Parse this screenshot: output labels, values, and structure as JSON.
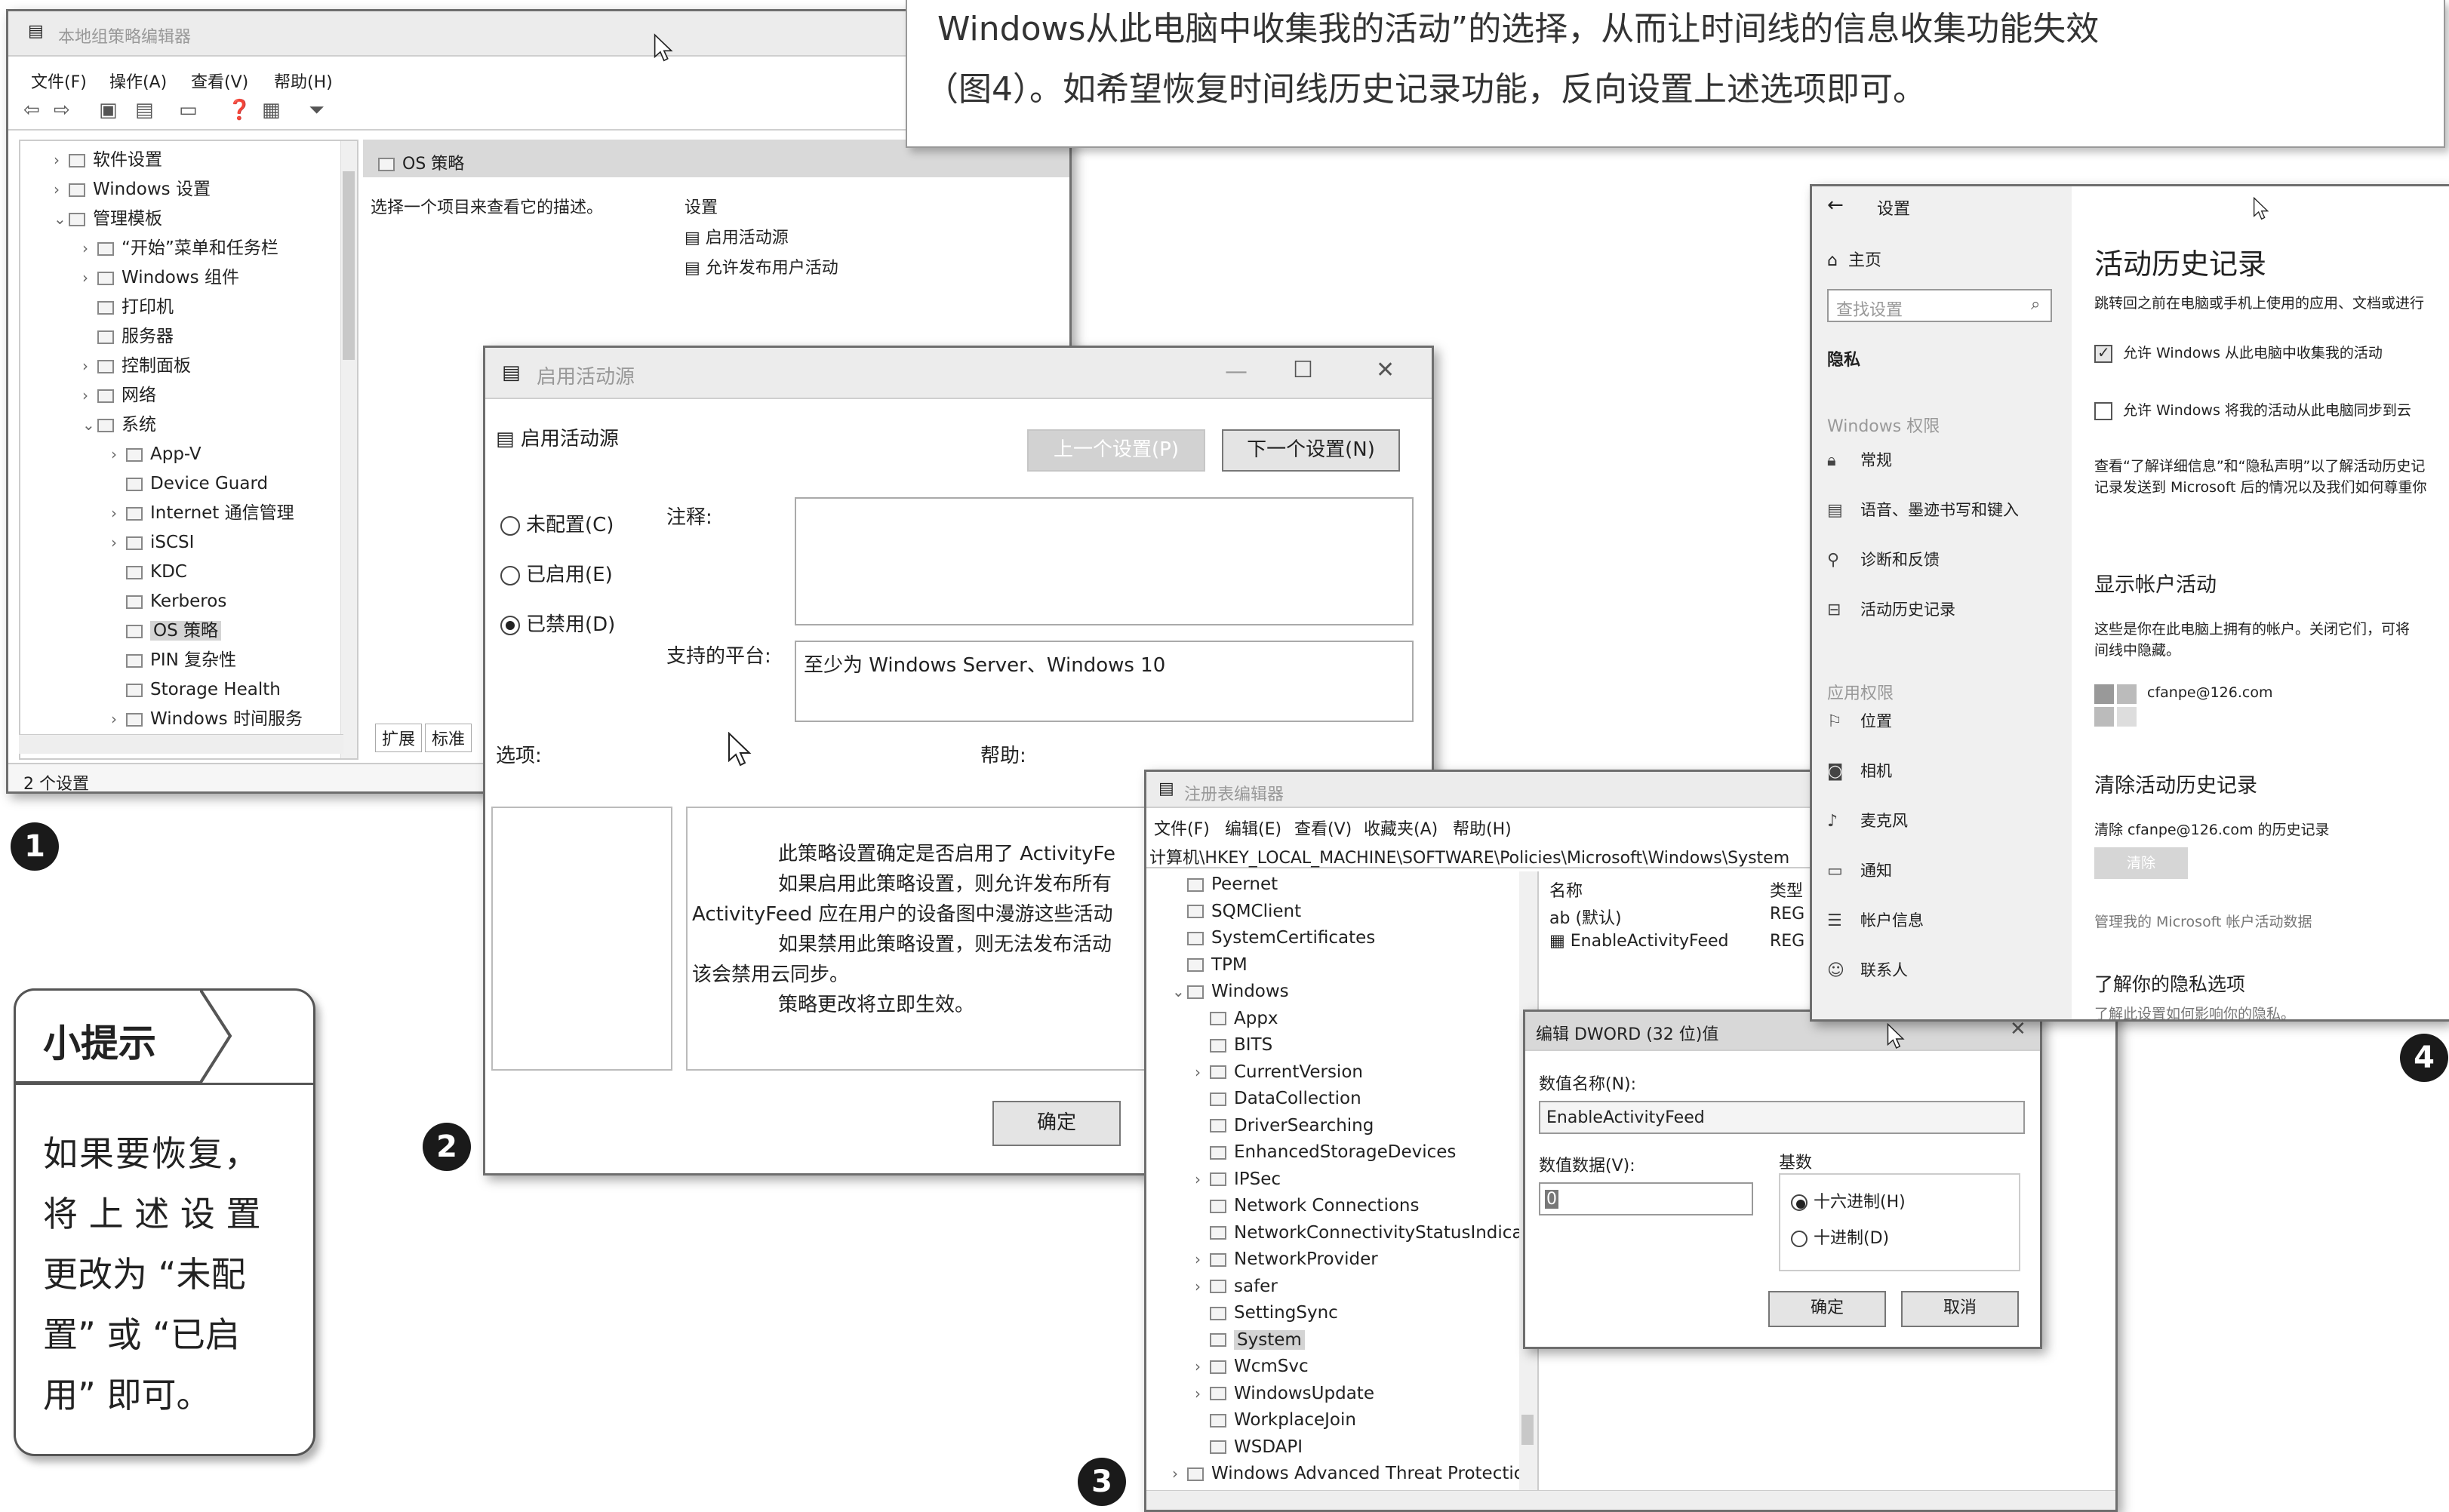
{
  "article": {
    "line1": "Windows从此电脑中收集我的活动”的选择，从而让时间线的信息收集功能失效",
    "line2": "（图4）。如希望恢复时间线历史记录功能，反向设置上述选项即可。"
  },
  "tip": {
    "title": "小提示",
    "body": [
      "如果要恢复，",
      "将 上 述 设 置",
      "更改为 “未配",
      "置” 或 “已启",
      "用” 即可。"
    ]
  },
  "badges": [
    "1",
    "2",
    "3",
    "4"
  ],
  "gpedit": {
    "title": "本地组策略编辑器",
    "menu": [
      "文件(F)",
      "操作(A)",
      "查看(V)",
      "帮助(H)"
    ],
    "tree": [
      {
        "label": "软件设置",
        "indent": 1,
        "arrow": ">"
      },
      {
        "label": "Windows 设置",
        "indent": 1,
        "arrow": ">"
      },
      {
        "label": "管理模板",
        "indent": 1,
        "arrow": "v"
      },
      {
        "label": "“开始”菜单和任务栏",
        "indent": 2,
        "arrow": ">"
      },
      {
        "label": "Windows 组件",
        "indent": 2,
        "arrow": ">"
      },
      {
        "label": "打印机",
        "indent": 2,
        "arrow": ""
      },
      {
        "label": "服务器",
        "indent": 2,
        "arrow": ""
      },
      {
        "label": "控制面板",
        "indent": 2,
        "arrow": ">"
      },
      {
        "label": "网络",
        "indent": 2,
        "arrow": ">"
      },
      {
        "label": "系统",
        "indent": 2,
        "arrow": "v"
      },
      {
        "label": "App-V",
        "indent": 3,
        "arrow": ">"
      },
      {
        "label": "Device Guard",
        "indent": 3,
        "arrow": ""
      },
      {
        "label": "Internet 通信管理",
        "indent": 3,
        "arrow": ">"
      },
      {
        "label": "iSCSI",
        "indent": 3,
        "arrow": ">"
      },
      {
        "label": "KDC",
        "indent": 3,
        "arrow": ""
      },
      {
        "label": "Kerberos",
        "indent": 3,
        "arrow": ""
      },
      {
        "label": "OS 策略",
        "indent": 3,
        "arrow": "",
        "selected": true
      },
      {
        "label": "PIN 复杂性",
        "indent": 3,
        "arrow": ""
      },
      {
        "label": "Storage Health",
        "indent": 3,
        "arrow": ""
      },
      {
        "label": "Windows 时间服务",
        "indent": 3,
        "arrow": ">"
      }
    ],
    "pane_header": "OS 策略",
    "pane_desc": "选择一个项目来查看它的描述。",
    "settings_header": "设置",
    "settings": [
      "启用活动源",
      "允许发布用户活动"
    ],
    "tabs": [
      "扩展",
      "标准"
    ],
    "status": "2 个设置"
  },
  "policy_dialog": {
    "title": "启用活动源",
    "name": "启用活动源",
    "prev_btn": "上一个设置(P)",
    "next_btn": "下一个设置(N)",
    "radio_unconfigured": "未配置(C)",
    "radio_enabled": "已启用(E)",
    "radio_disabled": "已禁用(D)",
    "comment_label": "注释:",
    "platform_label": "支持的平台:",
    "platform_value": "至少为 Windows Server、Windows 10",
    "options_label": "选项:",
    "help_label": "帮助:",
    "help_lines": [
      "此策略设置确定是否启用了 ActivityFe",
      "如果启用此策略设置，则允许发布所有",
      "ActivityFeed 应在用户的设备图中漫游这些活动",
      "如果禁用此策略设置，则无法发布活动",
      "该会禁用云同步。",
      "策略更改将立即生效。"
    ],
    "ok": "确定"
  },
  "regedit": {
    "title": "注册表编辑器",
    "menu": [
      "文件(F)",
      "编辑(E)",
      "查看(V)",
      "收藏夹(A)",
      "帮助(H)"
    ],
    "path": "计算机\\HKEY_LOCAL_MACHINE\\SOFTWARE\\Policies\\Microsoft\\Windows\\System",
    "tree": [
      {
        "label": "Peernet",
        "indent": 1
      },
      {
        "label": "SQMClient",
        "indent": 1
      },
      {
        "label": "SystemCertificates",
        "indent": 1
      },
      {
        "label": "TPM",
        "indent": 1
      },
      {
        "label": "Windows",
        "indent": 1,
        "arrow": "v"
      },
      {
        "label": "Appx",
        "indent": 2
      },
      {
        "label": "BITS",
        "indent": 2
      },
      {
        "label": "CurrentVersion",
        "indent": 2,
        "arrow": ">"
      },
      {
        "label": "DataCollection",
        "indent": 2
      },
      {
        "label": "DriverSearching",
        "indent": 2
      },
      {
        "label": "EnhancedStorageDevices",
        "indent": 2
      },
      {
        "label": "IPSec",
        "indent": 2,
        "arrow": ">"
      },
      {
        "label": "Network Connections",
        "indent": 2
      },
      {
        "label": "NetworkConnectivityStatusIndicator",
        "indent": 2
      },
      {
        "label": "NetworkProvider",
        "indent": 2,
        "arrow": ">"
      },
      {
        "label": "safer",
        "indent": 2,
        "arrow": ">"
      },
      {
        "label": "SettingSync",
        "indent": 2
      },
      {
        "label": "System",
        "indent": 2,
        "selected": true
      },
      {
        "label": "WcmSvc",
        "indent": 2,
        "arrow": ">"
      },
      {
        "label": "WindowsUpdate",
        "indent": 2,
        "arrow": ">"
      },
      {
        "label": "WorkplaceJoin",
        "indent": 2
      },
      {
        "label": "WSDAPI",
        "indent": 2
      },
      {
        "label": "Windows Advanced Threat Protection",
        "indent": 1,
        "arrow": ">"
      }
    ],
    "col_name": "名称",
    "col_type": "类型",
    "values": [
      {
        "name": "(默认)",
        "type": "REG"
      },
      {
        "name": "EnableActivityFeed",
        "type": "REG"
      }
    ]
  },
  "dword_dialog": {
    "title": "编辑 DWORD (32 位)值",
    "name_label": "数值名称(N):",
    "name_value": "EnableActivityFeed",
    "data_label": "数值数据(V):",
    "data_value": "0",
    "base_label": "基数",
    "hex": "十六进制(H)",
    "dec": "十进制(D)",
    "ok": "确定",
    "cancel": "取消"
  },
  "settings": {
    "back": "←",
    "title": "设置",
    "home": "主页",
    "search_placeholder": "查找设置",
    "section": "隐私",
    "group1": "Windows 权限",
    "nav1": [
      "常规",
      "语音、墨迹书写和键入",
      "诊断和反馈",
      "活动历史记录"
    ],
    "group2": "应用权限",
    "nav2": [
      "位置",
      "相机",
      "麦克风",
      "通知",
      "帐户信息",
      "联系人"
    ],
    "page_title": "活动历史记录",
    "page_intro": "跳转回之前在电脑或手机上使用的应用、文档或进行",
    "chk1": "允许 Windows 从此电脑中收集我的活动",
    "chk2": "允许 Windows 将我的活动从此电脑同步到云",
    "privacy_text1": "查看“了解详细信息”和“隐私声明”以了解活动历史记",
    "privacy_text2": "记录发送到 Microsoft 后的情况以及我们如何尊重你",
    "accounts_title": "显示帐户活动",
    "accounts_text1": "这些是你在此电脑上拥有的帐户。关闭它们，可将",
    "accounts_text2": "间线中隐藏。",
    "account_email": "cfanpe@126.com",
    "clear_title": "清除活动历史记录",
    "clear_text": "清除 cfanpe@126.com 的历史记录",
    "clear_btn": "清除",
    "manage_link": "管理我的 Microsoft 帐户活动数据",
    "learn_title": "了解你的隐私选项",
    "learn_text": "了解此设置如何影响你的隐私。"
  }
}
